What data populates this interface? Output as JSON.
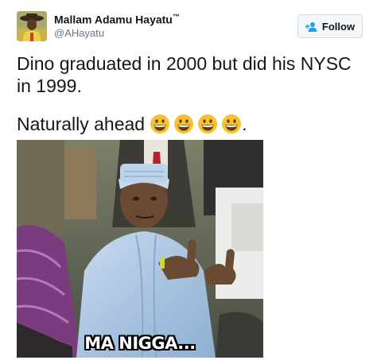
{
  "user": {
    "display_name": "Mallam Adamu Hayatu",
    "trademark": "™",
    "handle": "@AHayatu"
  },
  "follow_button": {
    "label": "Follow",
    "icon": "add-user-icon",
    "accent_color": "#1da1f2"
  },
  "tweet": {
    "line1": "Dino graduated in 2000 but did his NYSC in 1999.",
    "line2": "Naturally ahead",
    "emojis": [
      "grinning-face-icon",
      "grinning-face-icon",
      "grinning-face-icon",
      "grinning-face-icon"
    ],
    "trailing": "."
  },
  "media": {
    "caption": "MA NIGGA..."
  },
  "colors": {
    "text": "#14171a",
    "secondary": "#657786",
    "emoji_yellow": "#f7c12f"
  }
}
